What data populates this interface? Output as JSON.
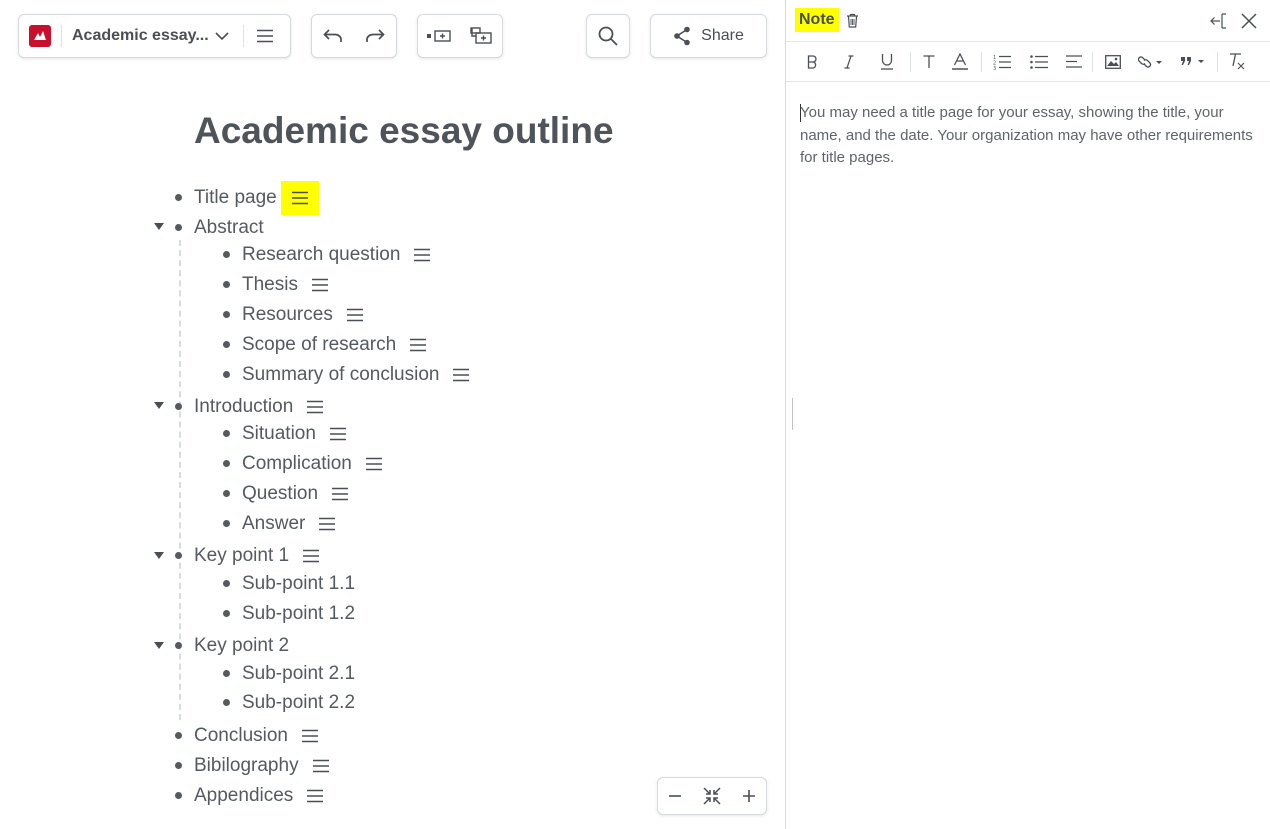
{
  "toolbar": {
    "doc_title": "Academic essay...",
    "share_label": "Share"
  },
  "outline": {
    "title": "Academic essay outline",
    "nodes": {
      "title_page": "Title page",
      "abstract": "Abstract",
      "research_question": "Research question",
      "thesis": "Thesis",
      "resources": "Resources",
      "scope_of_research": "Scope of research",
      "summary_of_conclusion": "Summary of conclusion",
      "introduction": "Introduction",
      "situation": "Situation",
      "complication": "Complication",
      "question": "Question",
      "answer": "Answer",
      "key_point_1": "Key point 1",
      "sub_point_1_1": "Sub-point 1.1",
      "sub_point_1_2": "Sub-point 1.2",
      "key_point_2": "Key point 2",
      "sub_point_2_1": "Sub-point 2.1",
      "sub_point_2_2": "Sub-point 2.2",
      "conclusion": "Conclusion",
      "bibliography": "Bibilography",
      "appendices": "Appendices"
    }
  },
  "note": {
    "label": "Note",
    "body": "You may need a title page for your essay, showing the title, your name, and the date. Your organization may have other requirements for title pages."
  },
  "colors": {
    "highlight": "#ffff00",
    "logo": "#c8102e",
    "text": "#555a61"
  }
}
